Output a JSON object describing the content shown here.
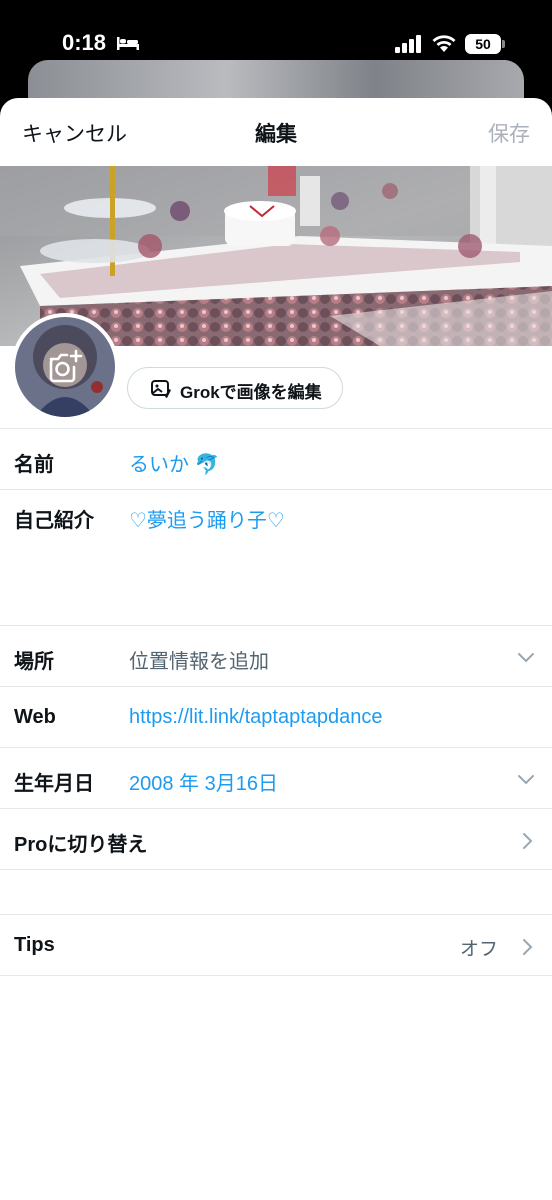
{
  "status": {
    "time": "0:18",
    "battery": "50"
  },
  "nav": {
    "cancel": "キャンセル",
    "title": "編集",
    "save": "保存"
  },
  "grok": {
    "label": "Grokで画像を編集"
  },
  "fields": {
    "name": {
      "label": "名前",
      "value": "るいか 🐬"
    },
    "bio": {
      "label": "自己紹介",
      "value": "♡夢追う踊り子♡"
    },
    "location": {
      "label": "場所",
      "placeholder": "位置情報を追加"
    },
    "web": {
      "label": "Web",
      "value": "https://lit.link/taptaptapdance"
    },
    "birthday": {
      "label": "生年月日",
      "value": "2008 年 3月16日"
    }
  },
  "pro": {
    "label": "Proに切り替え"
  },
  "tips": {
    "label": "Tips",
    "value": "オフ"
  },
  "colors": {
    "accent": "#1d9bf0",
    "text": "#0f1419",
    "muted": "#536471",
    "divider": "#e6e9ec"
  }
}
